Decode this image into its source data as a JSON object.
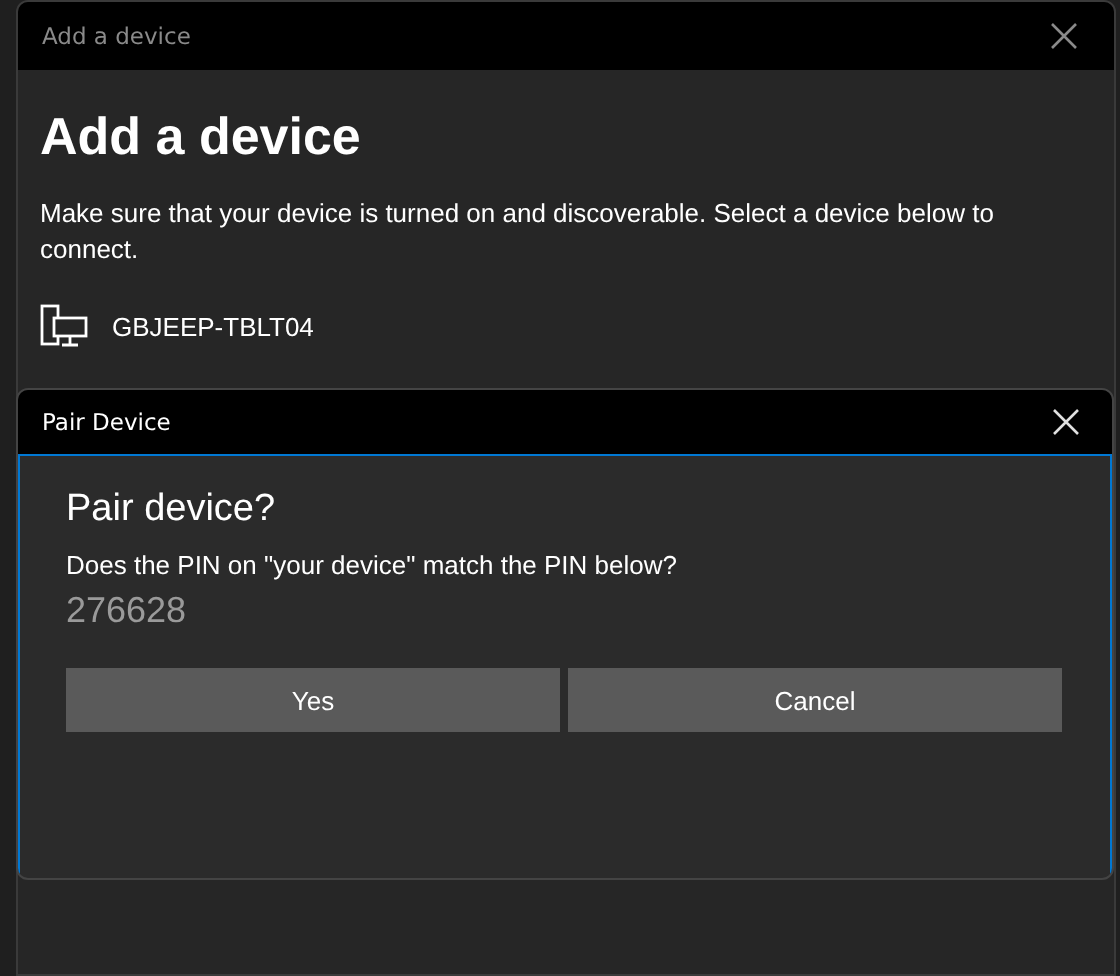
{
  "window": {
    "title": "Add a device"
  },
  "heading": "Add a device",
  "instructions": "Make sure that your device is turned on and discoverable. Select a device below to connect.",
  "devices": [
    {
      "name": "GBJEEP-TBLT04"
    }
  ],
  "dialog": {
    "title": "Pair Device",
    "heading": "Pair device?",
    "question": "Does the PIN on \"your device\" match the PIN below?",
    "pin": "276628",
    "buttons": [
      {
        "label": "Yes"
      },
      {
        "label": "Cancel"
      }
    ]
  }
}
